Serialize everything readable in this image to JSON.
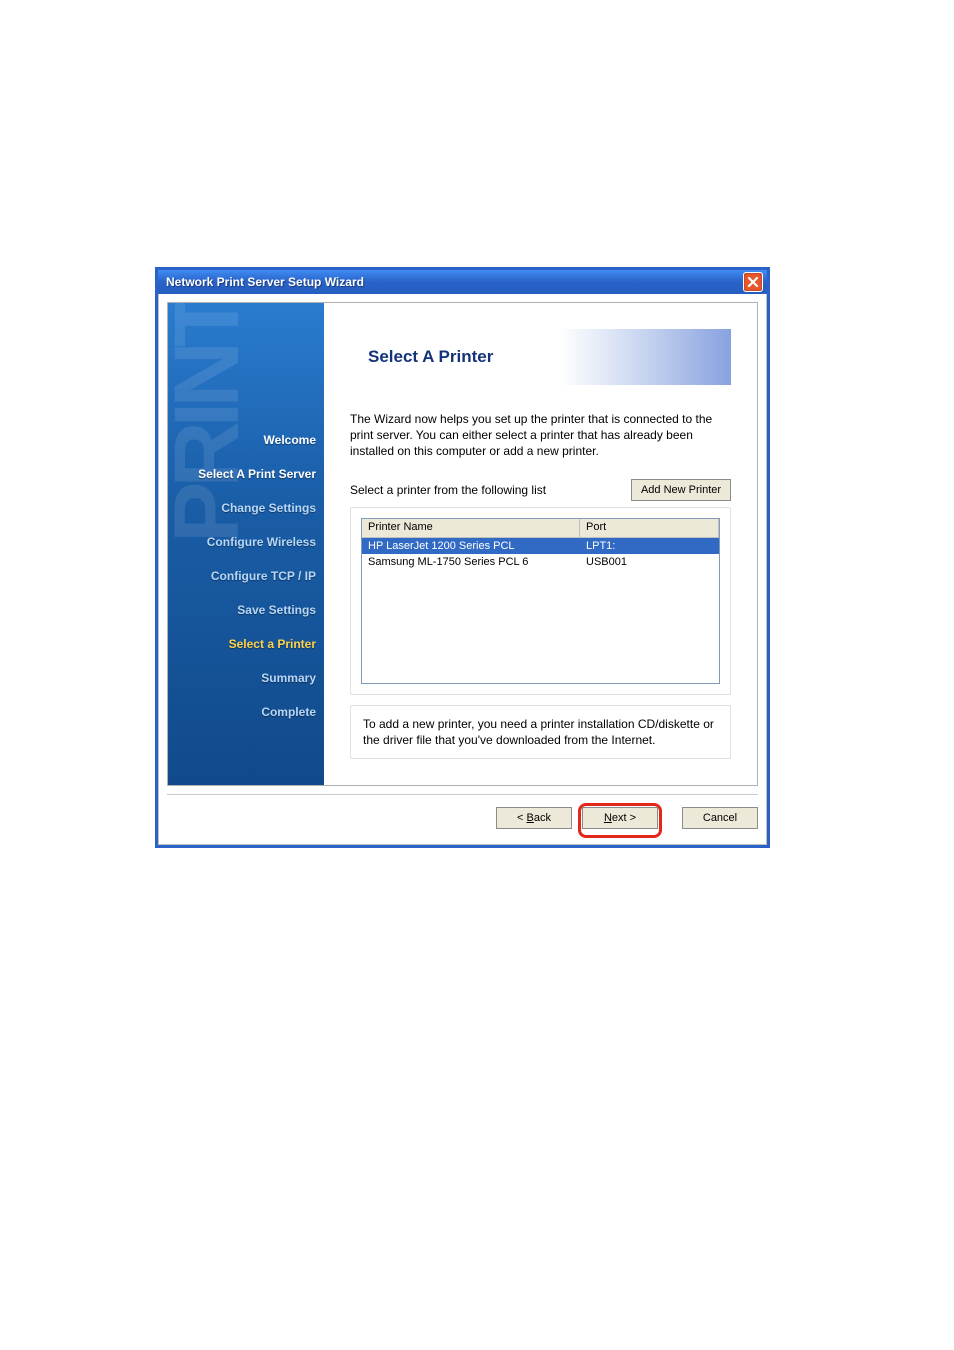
{
  "window": {
    "title": "Network Print Server Setup Wizard"
  },
  "sidebar": {
    "watermark": "PRINT",
    "steps": [
      {
        "label": "Welcome",
        "style": "white"
      },
      {
        "label": "Select A Print Server",
        "style": "white"
      },
      {
        "label": "Change Settings",
        "style": "normal"
      },
      {
        "label": "Configure Wireless",
        "style": "normal"
      },
      {
        "label": "Configure TCP / IP",
        "style": "normal"
      },
      {
        "label": "Save Settings",
        "style": "normal"
      },
      {
        "label": "Select a Printer",
        "style": "active"
      },
      {
        "label": "Summary",
        "style": "normal"
      },
      {
        "label": "Complete",
        "style": "normal"
      }
    ]
  },
  "header": {
    "title": "Select A Printer"
  },
  "intro": "The Wizard now helps you set up the printer that is connected to the print server. You can either select a printer that has already been installed on this computer or add a new printer.",
  "list_prompt": "Select a printer from the following list",
  "add_button": "Add New Printer",
  "columns": {
    "name": "Printer Name",
    "port": "Port"
  },
  "printers": [
    {
      "name": "HP LaserJet 1200 Series PCL",
      "port": "LPT1:",
      "selected": true
    },
    {
      "name": "Samsung ML-1750 Series PCL 6",
      "port": "USB001",
      "selected": false
    }
  ],
  "hint": "To add a new printer, you need a printer installation CD/diskette or the driver file that you've downloaded from the Internet.",
  "buttons": {
    "back_full": "< Back",
    "back_letter": "B",
    "back_prefix": "< ",
    "back_suffix": "ack",
    "next_full": "Next >",
    "next_letter": "N",
    "next_suffix": "ext >",
    "cancel": "Cancel"
  }
}
